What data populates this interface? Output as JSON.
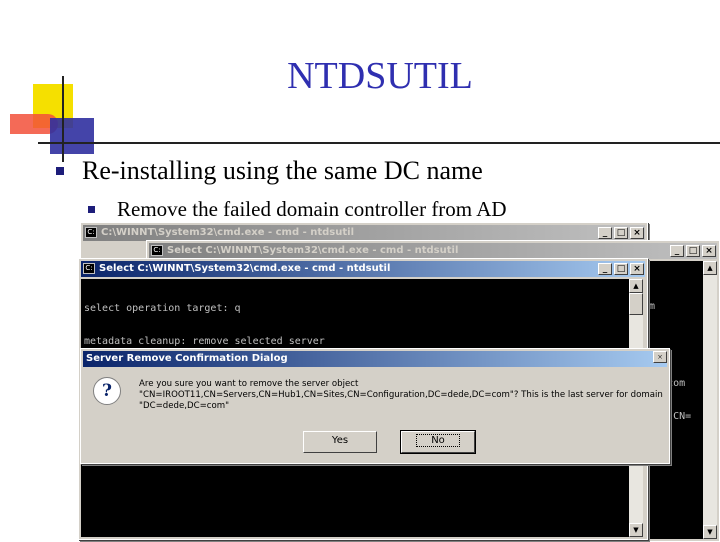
{
  "slide": {
    "title": "NTDSUTIL",
    "bullet1": "Re-installing using the same DC name",
    "bullet2": "Remove the failed domain controller from AD"
  },
  "windows": {
    "back": {
      "title": "C:\\WINNT\\System32\\cmd.exe - cmd - ntdsutil",
      "title_partial": "C:\\WINNT\\",
      "side_lines": [
        "om",
        ",DC=com",
        "ites,CN="
      ]
    },
    "middle": {
      "title": "Select C:\\WINNT\\System32\\cmd.exe - cmd - ntdsutil"
    },
    "front": {
      "title": "Select C:\\WINNT\\System32\\cmd.exe - cmd - ntdsutil",
      "console_lines": [
        "select operation target: q",
        "metadata cleanup: remove selected server",
        "_"
      ]
    }
  },
  "dialog": {
    "title": "Server Remove Confirmation Dialog",
    "message": "Are you sure you want to remove the server object \"CN=IROOT11,CN=Servers,CN=Hub1,CN=Sites,CN=Configuration,DC=dede,DC=com\"?  This is the last server for domain \"DC=dede,DC=com\"",
    "yes_label": "Yes",
    "no_label": "No"
  },
  "icons": {
    "window_controls": [
      "minimize-icon",
      "maximize-icon",
      "close-icon"
    ],
    "dialog_icon": "question-icon"
  },
  "colors": {
    "title_text": "#2f2fb0",
    "active_titlebar": "#0a246a",
    "console_bg": "#000000"
  }
}
